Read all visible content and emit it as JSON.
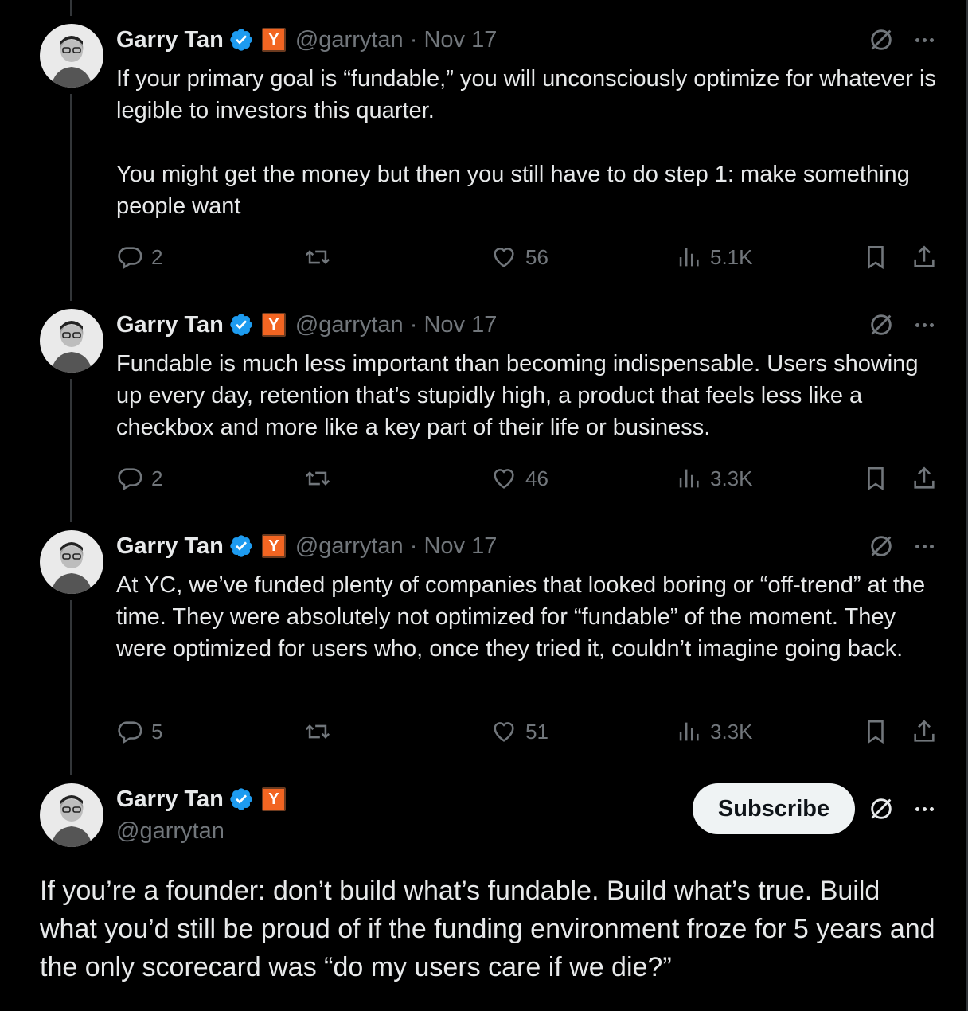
{
  "author": {
    "name": "Garry Tan",
    "handle": "@garrytan",
    "badge_label": "Y"
  },
  "tweets": [
    {
      "meta": "@garrytan · Nov 17",
      "text": "If your primary goal is “fundable,” you will unconsciously optimize for whatever is legible to investors this quarter.\n\nYou might get the money but then you still have to do step 1: make something people want",
      "replies": "2",
      "likes": "56",
      "views": "5.1K"
    },
    {
      "meta": "@garrytan · Nov 17",
      "text": "Fundable is much less important than becoming indispensable. Users showing up every day, retention that’s stupidly high, a product that feels less like a checkbox and more like a key part of their life or business.",
      "replies": "2",
      "likes": "46",
      "views": "3.3K"
    },
    {
      "meta": "@garrytan · Nov 17",
      "text": "At YC, we’ve funded plenty of companies that looked boring or “off-trend” at the time. They were absolutely not optimized for “fundable” of the moment. They were optimized for users who, once they tried it, couldn’t imagine going back.",
      "replies": "5",
      "likes": "51",
      "views": "3.3K"
    }
  ],
  "main_tweet": {
    "subscribe_label": "Subscribe",
    "text": "If you’re a founder: don’t build what’s fundable. Build what’s true. Build what you’d still be proud of if the funding environment froze for 5 years and the only scorecard was “do my users care if we die?”"
  },
  "colors": {
    "background": "#000000",
    "text": "#e7e9ea",
    "muted": "#71767b",
    "verified": "#1d9bf0",
    "yc_orange": "#f26522"
  },
  "icons": [
    "reply-icon",
    "retweet-icon",
    "like-icon",
    "views-icon",
    "bookmark-icon",
    "share-icon",
    "grok-icon",
    "more-icon",
    "verified-icon"
  ]
}
